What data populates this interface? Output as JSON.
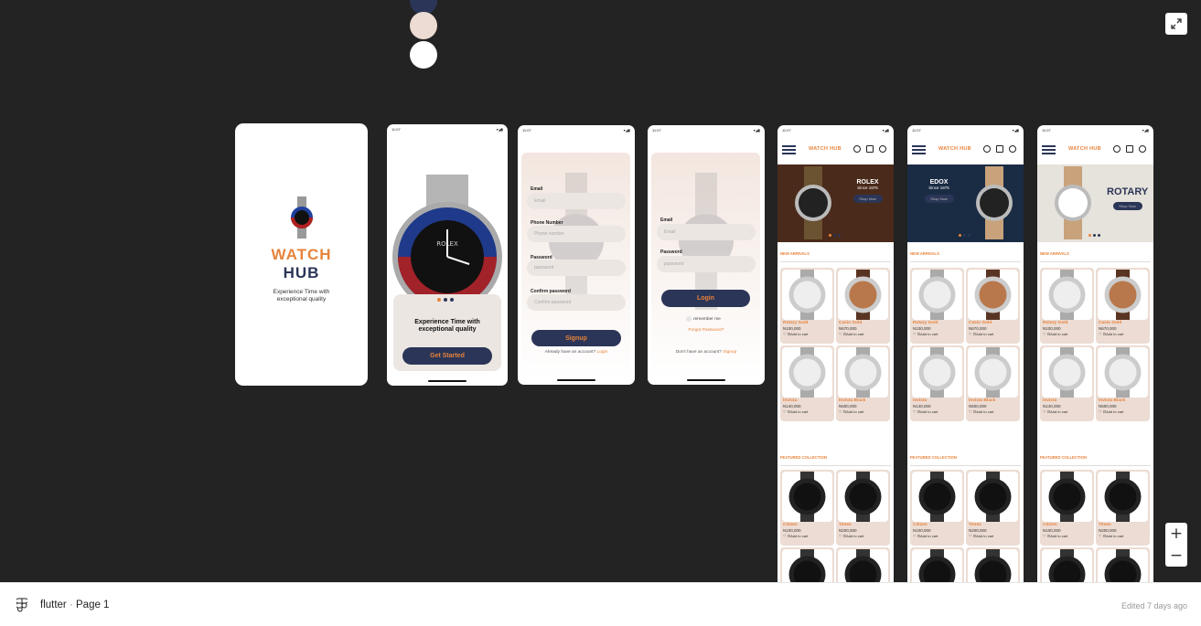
{
  "colors": {
    "navy": "#2b3557",
    "orange": "#e7833b",
    "beige": "#ecdcd3"
  },
  "swatches": [
    "#2b3557",
    "#ecdcd3",
    "#ffffff"
  ],
  "footer": {
    "file_name": "flutter",
    "page": "Page 1",
    "edited": "Edited 7 days ago"
  },
  "status_time": "11:07",
  "splash": {
    "logo_line1": "WATCH",
    "logo_line2": "HUB",
    "tagline_1": "Experience Time with",
    "tagline_2": "exceptional quality"
  },
  "onboard": {
    "title_1": "Experience Time with",
    "title_2": "exceptional quality",
    "button": "Get Started"
  },
  "signup": {
    "email_label": "Email",
    "email_ph": "Email",
    "phone_label": "Phone Number",
    "phone_ph": "Phone number",
    "password_label": "Password",
    "password_ph": "password",
    "confirm_label": "Confirm password",
    "confirm_ph": "Confirm password",
    "button": "Signup",
    "footer_text": "Already have an account?",
    "footer_link": "Login"
  },
  "login": {
    "email_label": "Email",
    "email_ph": "Email",
    "password_label": "Password",
    "password_ph": "password",
    "button": "Login",
    "remember": "remember me",
    "forgot": "Forgot Password?",
    "footer_text": "Don't have an account?",
    "footer_link": "Signup"
  },
  "home": {
    "logo": "WATCH HUB",
    "banners": [
      {
        "brand": "ROLEX",
        "since": "Since 1975",
        "cta": "Shop Now"
      },
      {
        "brand": "EDOX",
        "since": "Since 1975",
        "cta": "Shop Now"
      },
      {
        "brand": "ROTARY",
        "since": "",
        "cta": "Shop Now"
      }
    ],
    "new_arrivals": "NEW ARRIVALS",
    "featured": "FEATURED COLLECTION",
    "add_to_cart": "Add to cart",
    "products": [
      {
        "name": "Rotary Gold",
        "price": "N100,000"
      },
      {
        "name": "Casio Gold",
        "price": "N670,000"
      },
      {
        "name": "Invicta",
        "price": "N140,000"
      },
      {
        "name": "Invicta Black",
        "price": "N500,000"
      },
      {
        "name": "Citizen",
        "price": "N100,000"
      },
      {
        "name": "Timex",
        "price": "N200,000"
      }
    ]
  }
}
